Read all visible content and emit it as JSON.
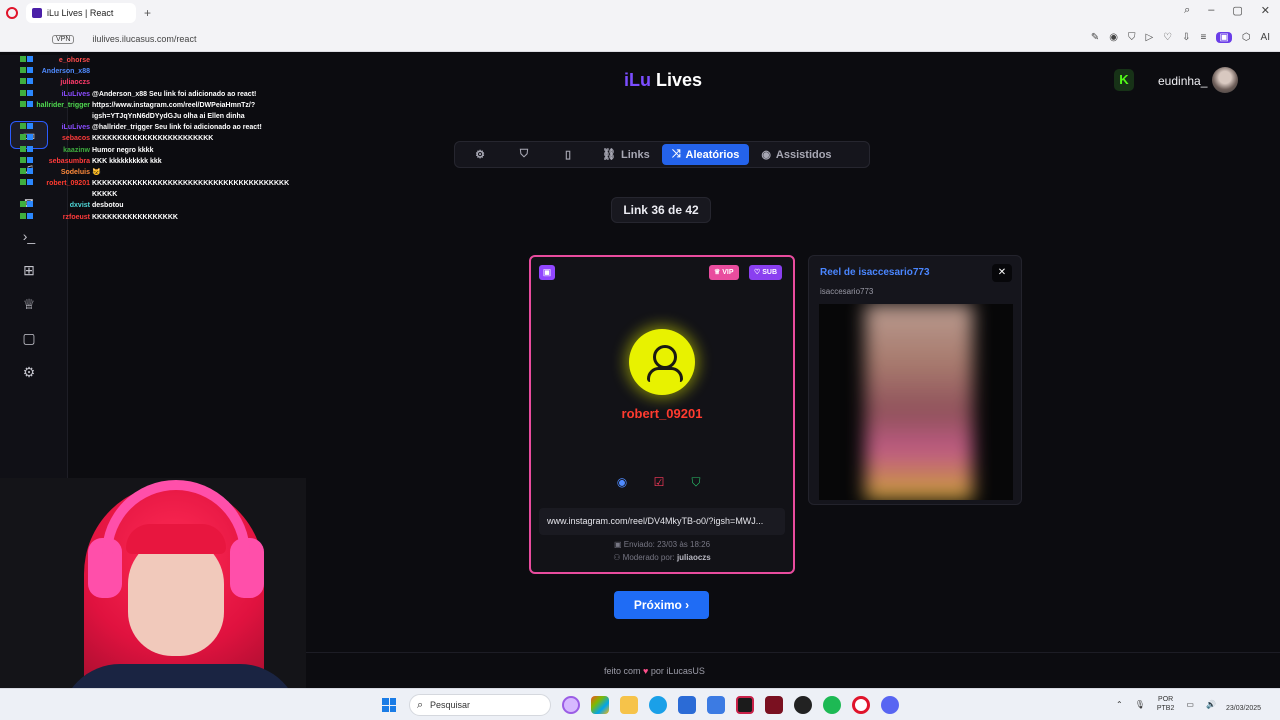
{
  "browser": {
    "tab_title": "iLu Lives | React",
    "url": "ilulives.ilucasus.com/react",
    "vpn": "VPN",
    "ai_label": "AI"
  },
  "header": {
    "brand_prefix": "iLu",
    "brand_suffix": " Lives",
    "kick_badge": "K",
    "username": "eudinha_"
  },
  "tabs": {
    "links": "Links",
    "random": "Aleatórios",
    "watched": "Assistidos"
  },
  "counter": "Link 36 de 42",
  "card": {
    "vip": "VIP",
    "sub": "SUB",
    "user": "robert_09201",
    "link": "www.instagram.com/reel/DV4MkyTB-o0/?igsh=MWJ...",
    "sent": "Enviado: 23/03 às 18:26",
    "mod_label": "Moderado por:",
    "mod_user": "juliaoczs"
  },
  "preview": {
    "title": "Reel de isaccesario773",
    "handle": "isaccesario773",
    "close": "✕"
  },
  "next_button": "Próximo ›",
  "footer": {
    "prefix": "feito com",
    "heart": "♥",
    "suffix": "por iLucasUS"
  },
  "chat": [
    {
      "user": "e_ohorse",
      "color": "#ff4d4d",
      "msg": ""
    },
    {
      "user": "Anderson_x88",
      "color": "#4f8bff",
      "msg": ""
    },
    {
      "user": "juliaoczs",
      "color": "#ff3b6b",
      "msg": ""
    },
    {
      "user": "iLuLives",
      "color": "#8a4dff",
      "msg": "@Anderson_x88 Seu link foi adicionado ao react!"
    },
    {
      "user": "hallrider_trigger",
      "color": "#4fd94f",
      "msg": "https://www.instagram.com/reel/DWPeiaHmnTz/?"
    },
    {
      "user": "",
      "color": "#ffffff",
      "msg": "igsh=YTJqYnN6dDYydGJu olha ai Ellen dinha"
    },
    {
      "user": "iLuLives",
      "color": "#8a4dff",
      "msg": "@hallrider_trigger Seu link foi adicionado ao react!"
    },
    {
      "user": "sebacos",
      "color": "#ff3b3b",
      "msg": "KKKKKKKKKKKKKKKKKKKKKKKK"
    },
    {
      "user": "kaazinw",
      "color": "#3fae3f",
      "msg": "Humor negro kkkk"
    },
    {
      "user": "sebasumbra",
      "color": "#ff3b3b",
      "msg": "KKK kkkkkkkkkk kkk"
    },
    {
      "user": "Sodeluis",
      "color": "#ff8a3b",
      "msg": "😺"
    },
    {
      "user": "robert_09201",
      "color": "#ff3b2f",
      "msg": "KKKKKKKKKKKKKKKKKKKKKKKKKKKKKKKKKKKKKKK"
    },
    {
      "user": "",
      "color": "#ffffff",
      "msg": "KKKKK"
    },
    {
      "user": "dxvist",
      "color": "#4fd9d9",
      "msg": "desbotou"
    },
    {
      "user": "rzfoeust",
      "color": "#ff3b3b",
      "msg": "KKKKKKKKKKKKKKKKK"
    }
  ],
  "taskbar": {
    "search": "Pesquisar",
    "lang1": "POR",
    "lang2": "PTB2",
    "date": "23/03/2025"
  },
  "colors": {
    "accent": "#2463eb",
    "card_border": "#e94c9e",
    "brand": "#7b4dff",
    "kick": "#53fc18"
  },
  "icons": {
    "sidebar": [
      "monitor-icon",
      "music-icon",
      "camera-icon",
      "terminal-icon",
      "gift-icon",
      "award-icon",
      "chat-icon",
      "gear-icon",
      "bell-icon",
      "help-icon",
      "logout-icon"
    ]
  }
}
